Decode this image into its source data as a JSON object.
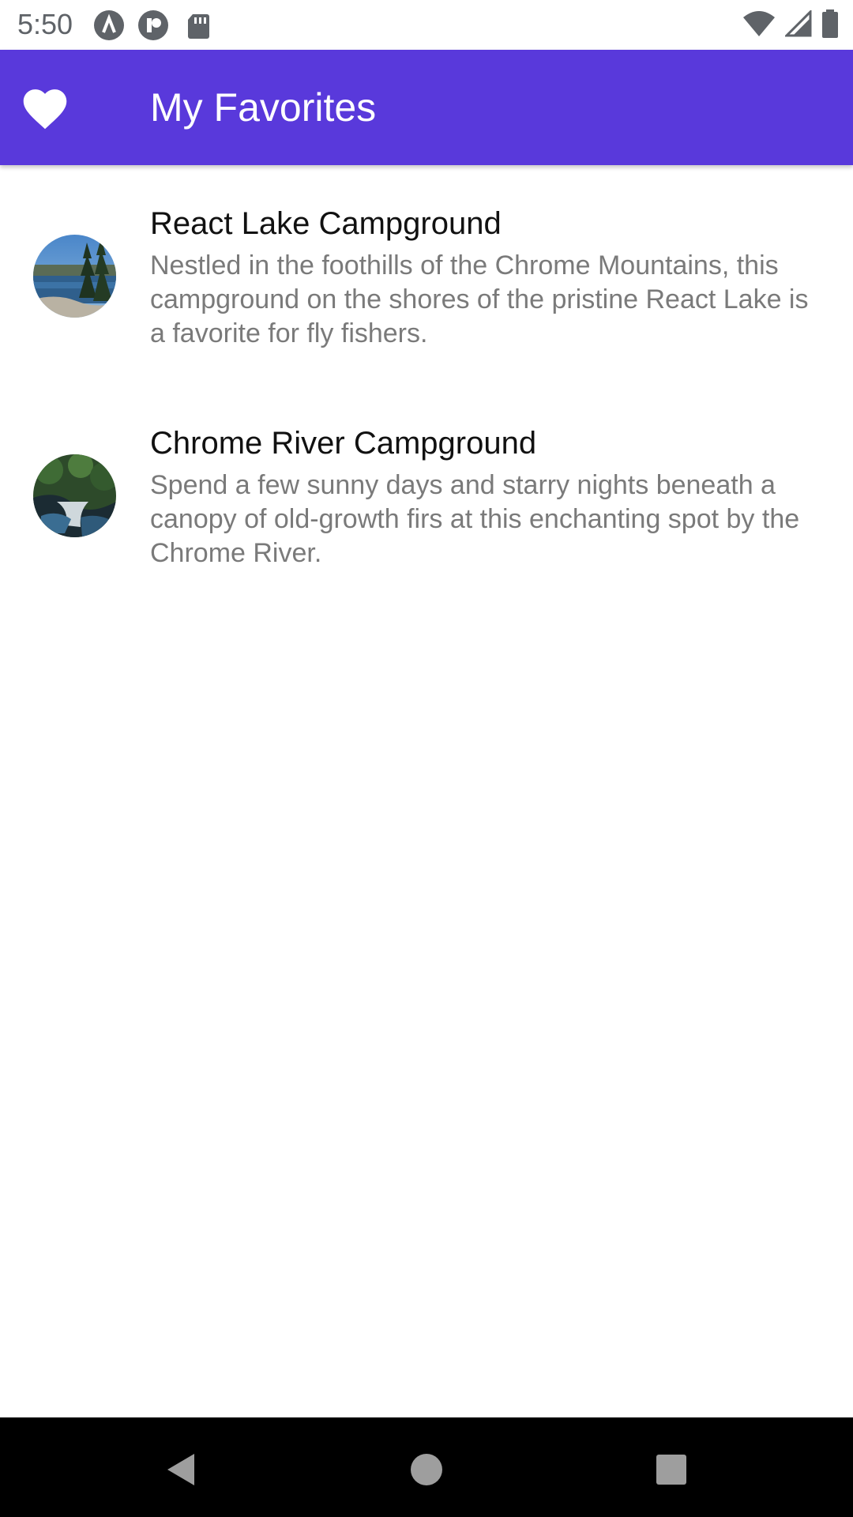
{
  "status_bar": {
    "time": "5:50",
    "left_icons": [
      "app-notification-icon",
      "app-notification-icon",
      "sd-card-icon"
    ],
    "right_icons": [
      "wifi-icon",
      "signal-icon",
      "battery-icon"
    ]
  },
  "app_bar": {
    "title": "My Favorites",
    "icon": "heart-icon",
    "background": "#5939db"
  },
  "favorites": [
    {
      "title": "React Lake Campground",
      "description": "Nestled in the foothills of the Chrome Mountains, this campground on the shores of the pristine React Lake is a favorite for fly fishers."
    },
    {
      "title": "Chrome River Campground",
      "description": "Spend a few sunny days and starry nights beneath a canopy of old-growth firs at this enchanting spot by the Chrome River."
    }
  ],
  "nav_bar": {
    "buttons": [
      "back-icon",
      "home-icon",
      "recents-icon"
    ]
  }
}
